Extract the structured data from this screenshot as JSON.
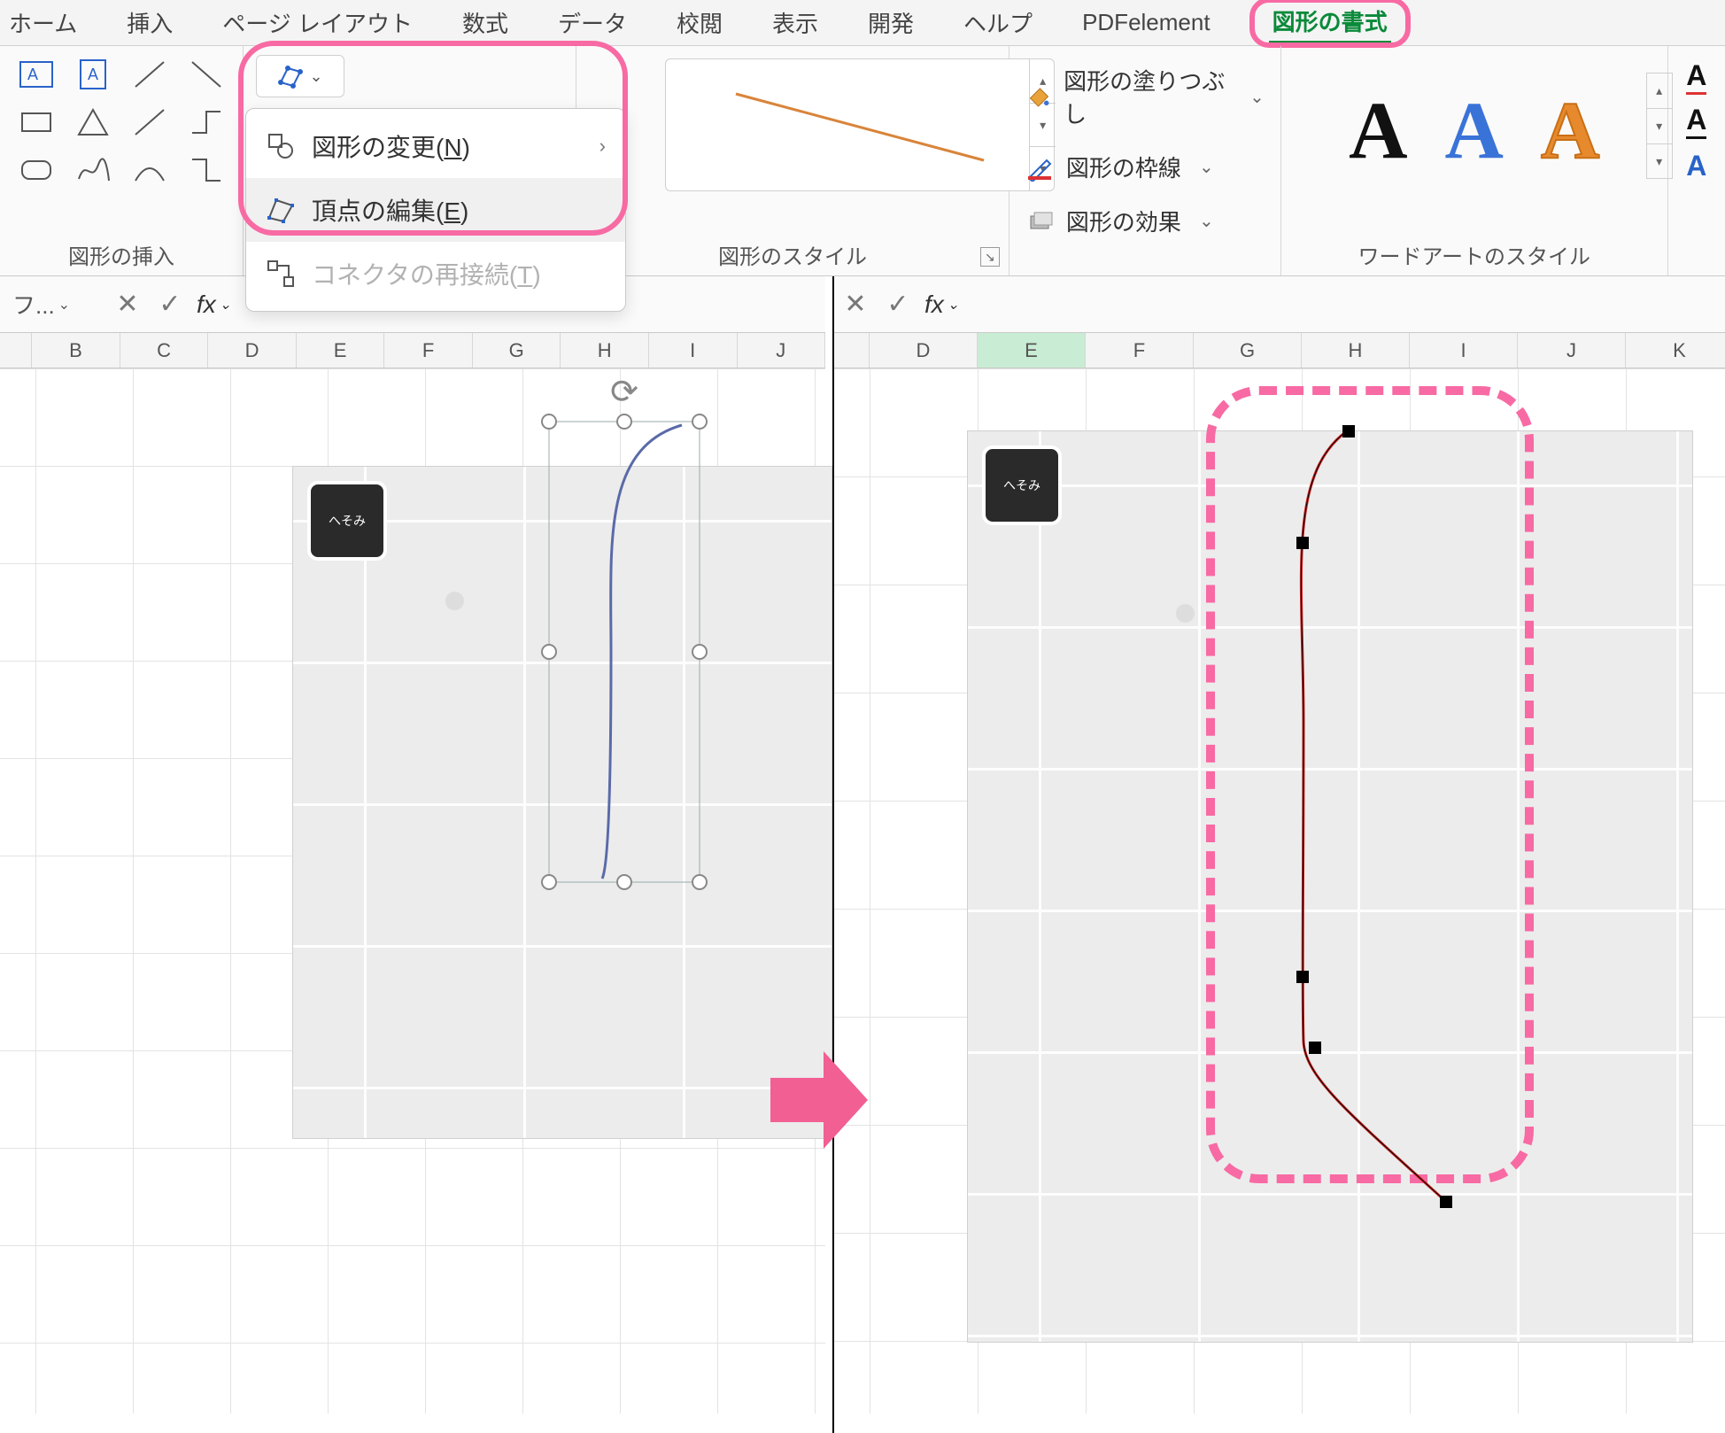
{
  "tabs": {
    "home": "ホーム",
    "insert": "挿入",
    "layout": "ページ レイアウト",
    "formula": "数式",
    "data": "データ",
    "review": "校閲",
    "view": "表示",
    "dev": "開発",
    "help": "ヘルプ",
    "pdfelement": "PDFelement",
    "shapefmt": "図形の書式"
  },
  "groups": {
    "insert_shapes": "図形の挿入",
    "shape_styles": "図形のスタイル",
    "wordart_styles": "ワードアートのスタイル"
  },
  "editshape_menu": {
    "change_shape": "図形の変更",
    "change_shape_key": "N",
    "edit_points": "頂点の編集",
    "edit_points_key": "E",
    "reroute": "コネクタの再接続",
    "reroute_key": "T"
  },
  "foe": {
    "fill": "図形の塗りつぶし",
    "outline": "図形の枠線",
    "effects": "図形の効果"
  },
  "wordart": {
    "a1": "A",
    "a2": "A",
    "a3": "A"
  },
  "txtfx": {
    "a": "A"
  },
  "namebox_left": "フ...",
  "fx_label": "fx",
  "col_left": [
    "B",
    "C",
    "D",
    "E",
    "F",
    "G",
    "H",
    "I",
    "J"
  ],
  "col_right": [
    "D",
    "E",
    "F",
    "G",
    "H",
    "I",
    "J",
    "K"
  ],
  "selected_col_right": "E",
  "map_badge": "へそみ"
}
